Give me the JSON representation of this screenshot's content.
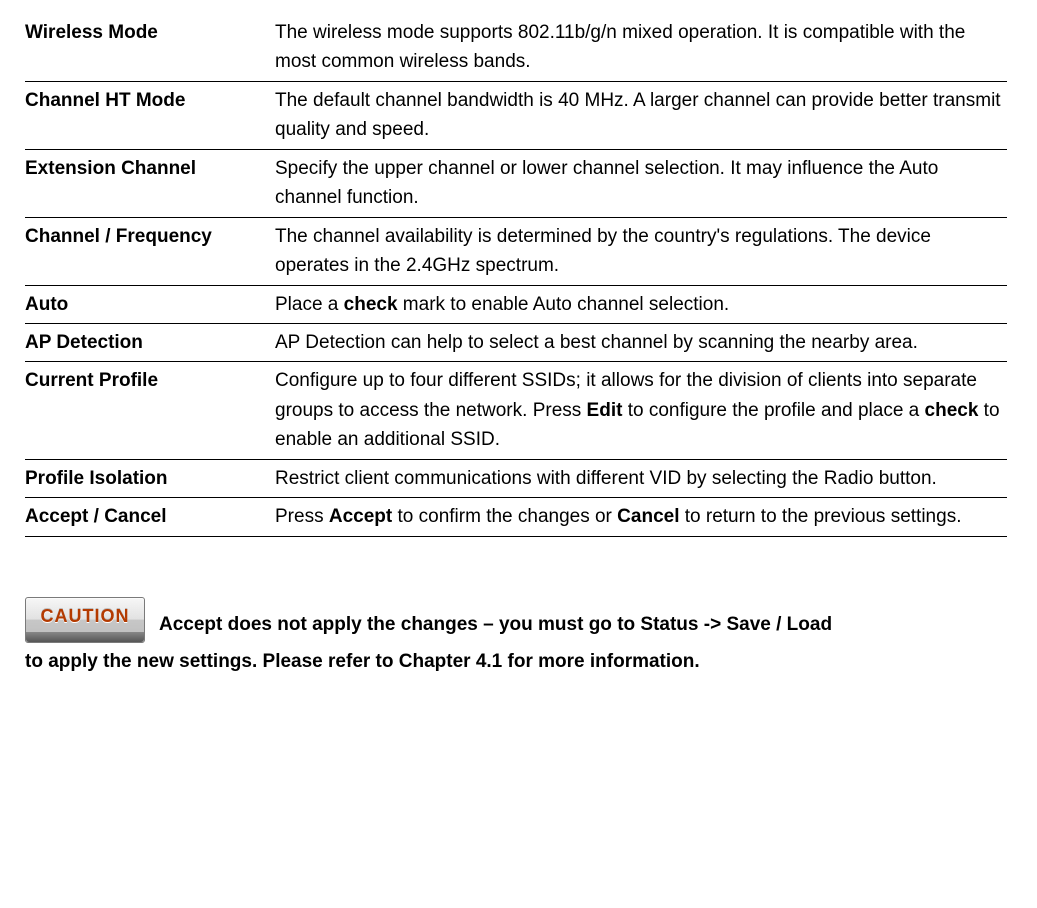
{
  "rows": [
    {
      "label": "Wireless Mode",
      "desc": "The wireless mode supports 802.11b/g/n mixed operation. It is compatible with the most common wireless bands."
    },
    {
      "label": "Channel HT Mode",
      "desc": "The default channel bandwidth is 40 MHz. A larger channel can provide better transmit quality and speed."
    },
    {
      "label": "Extension Channel",
      "desc": "Specify the upper channel or lower channel selection. It may influence the Auto channel function."
    },
    {
      "label": "Channel / Frequency",
      "desc": "The channel availability is determined by the country's regulations.   The device operates in the 2.4GHz spectrum."
    },
    {
      "label": "Auto",
      "desc_parts": [
        "Place a ",
        "check",
        " mark to enable Auto channel selection."
      ]
    },
    {
      "label": "AP Detection",
      "desc": "AP Detection can help to select a best channel by scanning the nearby area."
    },
    {
      "label": "Current Profile",
      "desc_parts": [
        "Configure up to four different SSIDs; it allows for the division of clients into separate groups to access the network. Press ",
        "Edit",
        " to configure the profile and place a ",
        "check",
        " to enable an additional SSID."
      ]
    },
    {
      "label": "Profile Isolation",
      "desc": "Restrict client communications with different VID by selecting the Radio button."
    },
    {
      "label": "Accept / Cancel",
      "desc_parts": [
        "Press ",
        "Accept",
        " to confirm the changes or ",
        "Cancel",
        " to return to the previous settings."
      ]
    }
  ],
  "caution": {
    "badge": "CAUTION",
    "line1": "Accept does not apply the changes – you must go to Status -> Save / Load",
    "line2": "to apply the new settings. Please refer to Chapter 4.1 for more information."
  }
}
